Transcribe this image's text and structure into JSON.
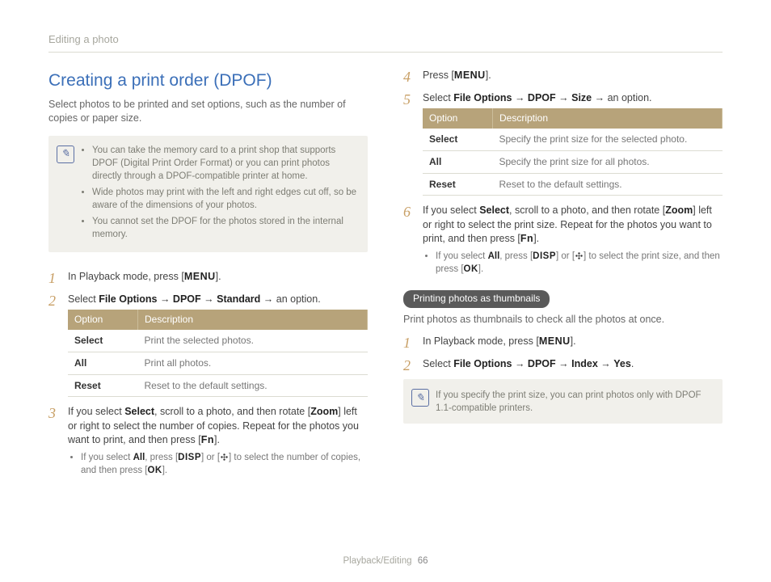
{
  "header": "Editing a photo",
  "section_title": "Creating a print order (DPOF)",
  "lead": "Select photos to be printed and set options, such as the number of copies or paper size.",
  "note_icon_glyph": "✎",
  "note1_items": [
    "You can take the memory card to a print shop that supports DPOF (Digital Print Order Format) or you can print photos directly through a DPOF-compatible printer at home.",
    "Wide photos may print with the left and right edges cut off, so be aware of the dimensions of your photos.",
    "You cannot set the DPOF for the photos stored in the internal memory."
  ],
  "keys": {
    "menu": "MENU",
    "fn": "Fn",
    "disp": "DISP",
    "ok": "OK"
  },
  "step1_pre": "In Playback mode, press [",
  "step1_post": "].",
  "step2_pre": "Select ",
  "nav1a": "File Options",
  "nav1b": "DPOF",
  "nav1c": "Standard",
  "step2_post": " an option.",
  "arrow": "→",
  "table1_h1": "Option",
  "table1_h2": "Description",
  "table1_rows": [
    {
      "opt": "Select",
      "desc": "Print the selected photos."
    },
    {
      "opt": "All",
      "desc": "Print all photos."
    },
    {
      "opt": "Reset",
      "desc": "Reset to the default settings."
    }
  ],
  "step3_a": "If you select ",
  "step3_sel": "Select",
  "step3_b": ", scroll to a photo, and then rotate [",
  "step3_zoom": "Zoom",
  "step3_c": "] left or right to select the number of copies. Repeat for the photos you want to print, and then press [",
  "step3_d": "].",
  "sub3_a": "If you select ",
  "sub3_all": "All",
  "sub3_b": ", press [",
  "sub3_c": "] or [",
  "sub3_d": "] to select the number of copies, and then press [",
  "sub3_e": "].",
  "step4_pre": "Press [",
  "step4_post": "].",
  "step5_pre": "Select ",
  "nav2a": "File Options",
  "nav2b": "DPOF",
  "nav2c": "Size",
  "step5_post": " an option.",
  "table2_h1": "Option",
  "table2_h2": "Description",
  "table2_rows": [
    {
      "opt": "Select",
      "desc": "Specify the print size for the selected photo."
    },
    {
      "opt": "All",
      "desc": "Specify the print size for all photos."
    },
    {
      "opt": "Reset",
      "desc": "Reset to the default settings."
    }
  ],
  "step6_a": "If you select ",
  "step6_sel": "Select",
  "step6_b": ", scroll to a photo, and then rotate [",
  "step6_zoom": "Zoom",
  "step6_c": "] left or right to select the print size. Repeat for the photos you want to print, and then press [",
  "step6_d": "].",
  "sub6_a": "If you select ",
  "sub6_all": "All",
  "sub6_b": ", press [",
  "sub6_c": "] or [",
  "sub6_d": "] to select the print size, and then press [",
  "sub6_e": "].",
  "pill": "Printing photos as thumbnails",
  "thumb_lead": "Print photos as thumbnails to check all the photos at once.",
  "t_step1_pre": "In Playback mode, press [",
  "t_step1_post": "].",
  "t_step2_pre": "Select ",
  "nav3a": "File Options",
  "nav3b": "DPOF",
  "nav3c": "Index",
  "nav3d": "Yes",
  "t_step2_post": ".",
  "note2_text": "If you specify the print size, you can print photos only with DPOF 1.1-compatible printers.",
  "footer_section": "Playback/Editing",
  "footer_page": "66"
}
